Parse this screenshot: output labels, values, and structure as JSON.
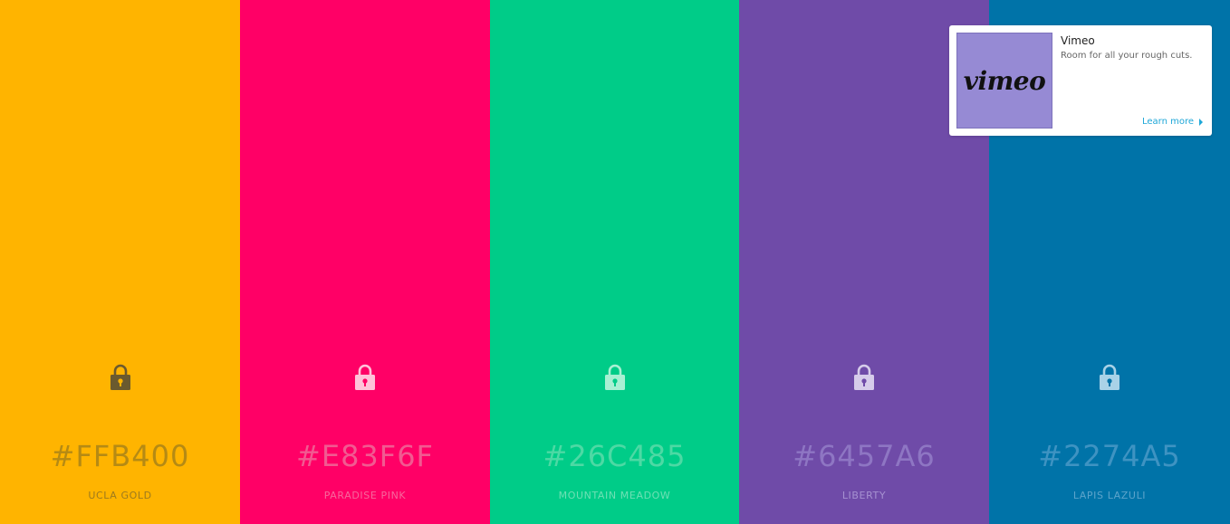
{
  "palette": {
    "swatches": [
      {
        "hex": "#FFB400",
        "name": "UCLA GOLD",
        "bg": "#FFB400",
        "text_color": "#B58A14",
        "name_color": "#9C7A1E",
        "lock_color": "#6B5A2E",
        "lock_hole": "#FFB400"
      },
      {
        "hex": "#E83F6F",
        "name": "PARADISE PINK",
        "bg": "#FF0066",
        "text_color": "#F15A91",
        "name_color": "#F7689C",
        "lock_color": "#FFC2D9",
        "lock_hole": "#FF0066"
      },
      {
        "hex": "#26C485",
        "name": "MOUNTAIN MEADOW",
        "bg": "#00CC88",
        "text_color": "#4DD9A4",
        "name_color": "#6FE0B4",
        "lock_color": "#A8F0D3",
        "lock_hole": "#00CC88"
      },
      {
        "hex": "#6457A6",
        "name": "LIBERTY",
        "bg": "#6F4BA8",
        "text_color": "#8E76C3",
        "name_color": "#A691D1",
        "lock_color": "#D6CCEA",
        "lock_hole": "#6F4BA8"
      },
      {
        "hex": "#2274A5",
        "name": "LAPIS LAZULI",
        "bg": "#0073A8",
        "text_color": "#3E93C2",
        "name_color": "#5DA4CB",
        "lock_color": "#A9D2E7",
        "lock_hole": "#0073A8"
      }
    ]
  },
  "ad": {
    "title": "Vimeo",
    "description": "Room for all your rough cuts.",
    "logo_text": "vimeo",
    "link_label": "Learn more"
  },
  "icons": {
    "lock": "lock-icon",
    "arrow": "chevron-right-icon"
  }
}
